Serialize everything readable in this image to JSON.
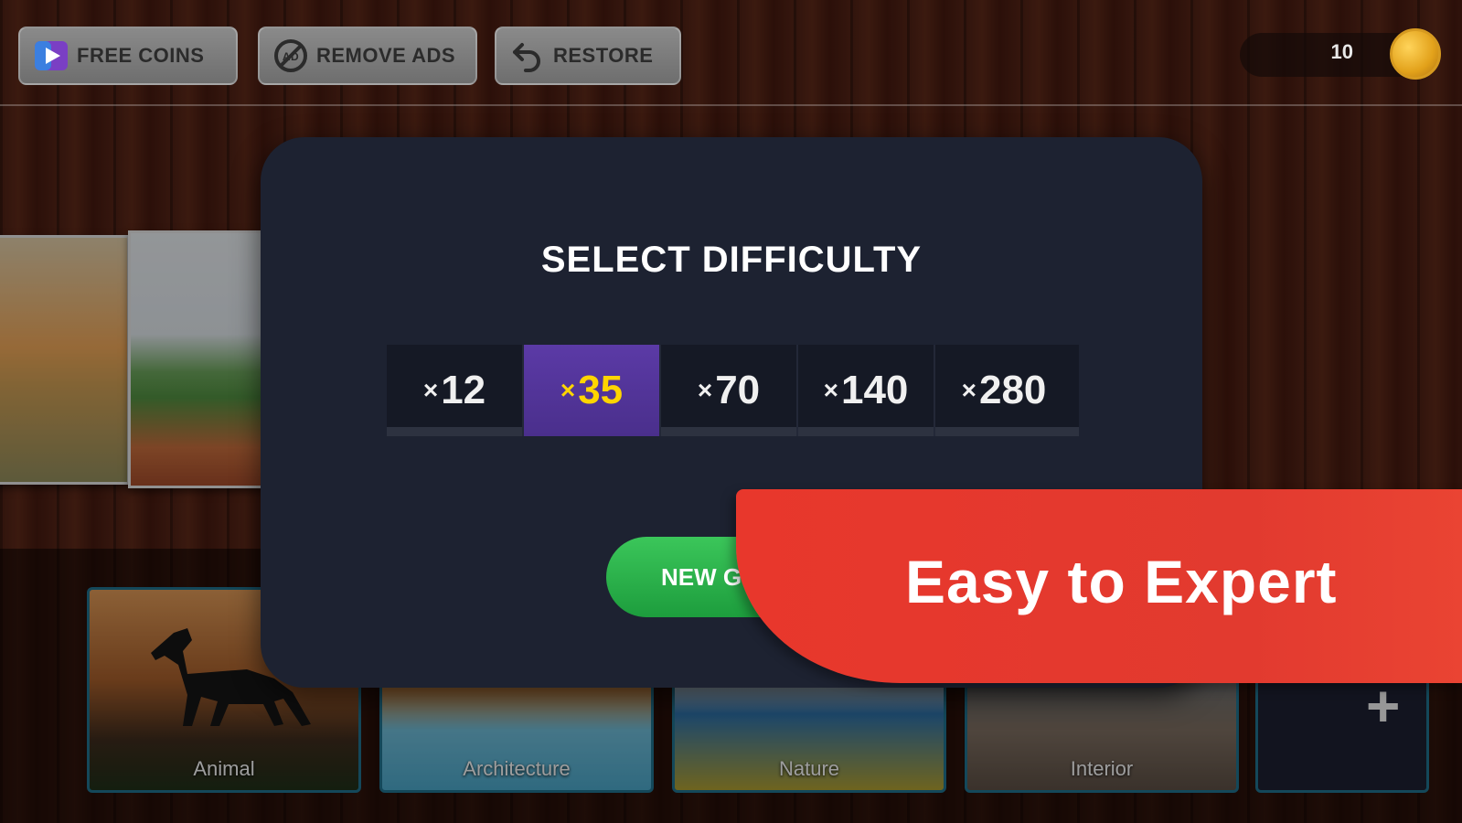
{
  "topbar": {
    "free_coins_label": "FREE COINS",
    "remove_ads_label": "REMOVE ADS",
    "restore_label": "RESTORE",
    "coin_count": "10"
  },
  "modal": {
    "title": "SELECT DIFFICULTY",
    "options": [
      {
        "x": "×",
        "value": "12",
        "selected": false
      },
      {
        "x": "×",
        "value": "35",
        "selected": true
      },
      {
        "x": "×",
        "value": "70",
        "selected": false
      },
      {
        "x": "×",
        "value": "140",
        "selected": false
      },
      {
        "x": "×",
        "value": "280",
        "selected": false
      }
    ],
    "new_game_label": "NEW G"
  },
  "categories": [
    {
      "label": "Animal"
    },
    {
      "label": "Architecture"
    },
    {
      "label": "Nature"
    },
    {
      "label": "Interior"
    }
  ],
  "banner": {
    "text": "Easy to Expert"
  },
  "colors": {
    "selected_option": "#4a2f8c",
    "selected_text": "#ffd500",
    "new_game": "#2db14c",
    "banner": "#e8372c",
    "modal_bg": "#1d2231"
  },
  "icons": {
    "free_coins": "video-play-icon",
    "remove_ads": "no-ads-icon",
    "restore": "undo-arrow-icon",
    "coin": "coin-icon",
    "add": "plus-icon"
  }
}
